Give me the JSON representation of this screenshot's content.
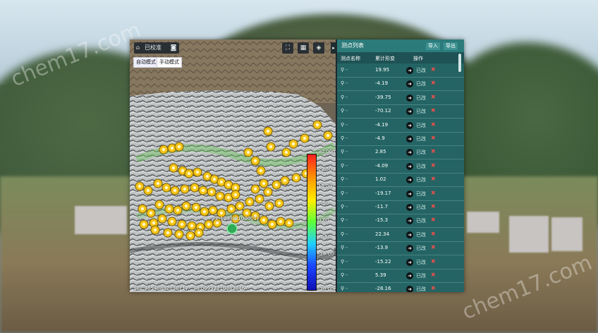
{
  "toolbar": {
    "calibrated_label": "已校准",
    "auto_mode_label": "自动模式",
    "manual_mode_label": "手动模式"
  },
  "map": {
    "tooltip_text": "23_1243(0100001)",
    "coordinates_text": "102.36540802010717 , 36.00992210382846",
    "legend": {
      "unit_top": "30.00mm",
      "ticks": [
        "22.50",
        "15.00",
        "7.50",
        "0.00",
        "-7.50",
        "-15.00",
        "-22.50"
      ],
      "bottom": "-30.00mm"
    }
  },
  "list": {
    "title": "测点列表",
    "import_label": "导入",
    "export_label": "导出",
    "columns": [
      "测点名称",
      "累计形变",
      "操作"
    ],
    "rows": [
      {
        "name": "-",
        "value": "19.95"
      },
      {
        "name": "-",
        "value": "-4.19"
      },
      {
        "name": "-",
        "value": "-39.75"
      },
      {
        "name": "-",
        "value": "-70.12"
      },
      {
        "name": "-",
        "value": "-4.19"
      },
      {
        "name": "-",
        "value": "-4.9"
      },
      {
        "name": "-",
        "value": "2.85"
      },
      {
        "name": "-",
        "value": "-4.09"
      },
      {
        "name": "-",
        "value": "1.02"
      },
      {
        "name": "-",
        "value": "-19.17"
      },
      {
        "name": "-",
        "value": "-11.7"
      },
      {
        "name": "-",
        "value": "-15.3"
      },
      {
        "name": "-",
        "value": "22.34"
      },
      {
        "name": "-",
        "value": "-13.9"
      },
      {
        "name": "-",
        "value": "-15.22"
      },
      {
        "name": "-",
        "value": "5.39"
      },
      {
        "name": "-",
        "value": "-28.16"
      }
    ],
    "edit_label": "已改"
  },
  "watermark": "chem17.com",
  "colors": {
    "marker_fill": "#f5c518",
    "marker_selected": "#2faa57",
    "list_bg": "#266c6c"
  }
}
